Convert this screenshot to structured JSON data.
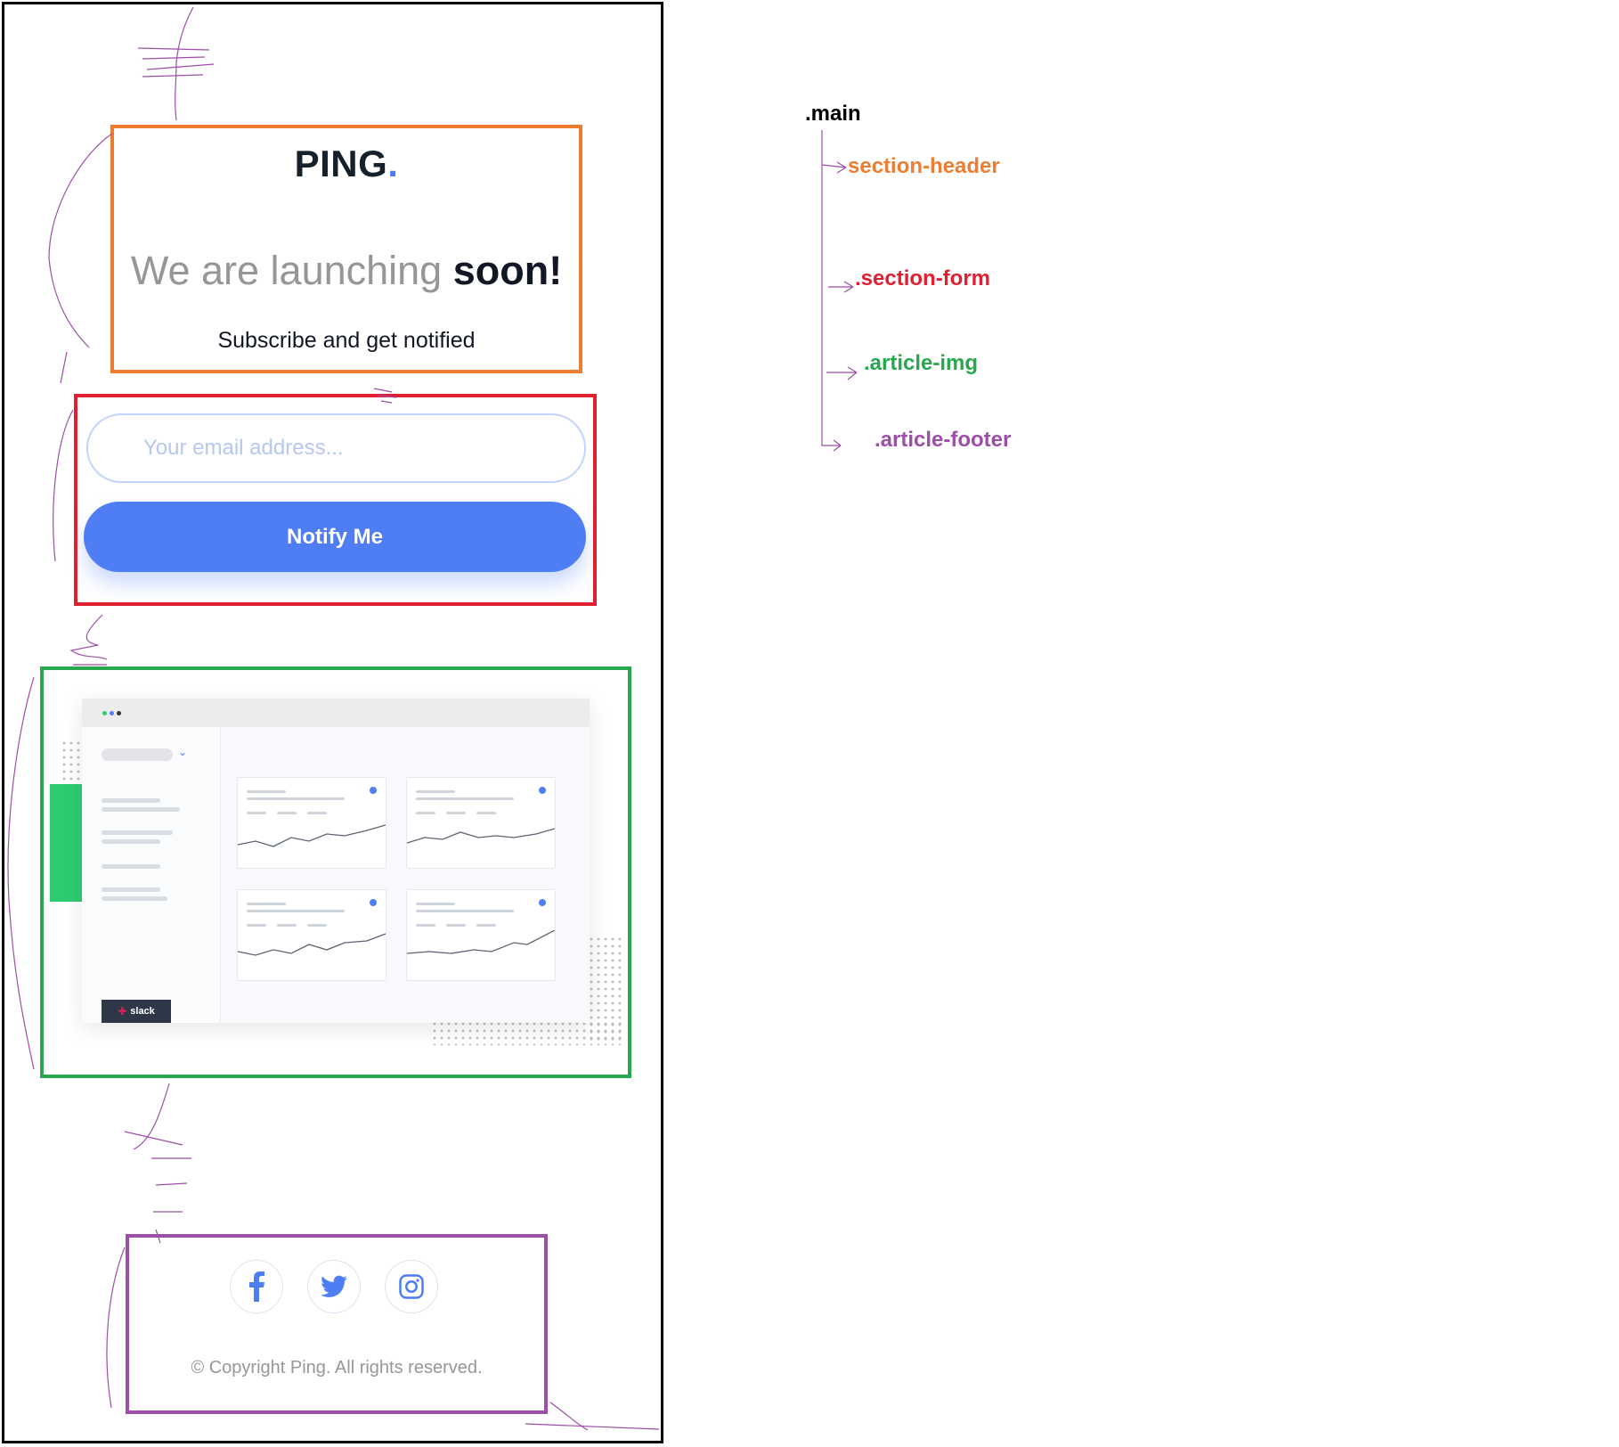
{
  "header": {
    "logo_text": "PING",
    "logo_dot": ".",
    "headline_light": "We are launching ",
    "headline_bold": "soon!",
    "subtitle": "Subscribe and get notified"
  },
  "form": {
    "email_placeholder": "Your email address...",
    "email_value": "",
    "button_label": "Notify Me"
  },
  "illustration": {
    "slack_label": "slack"
  },
  "footer": {
    "social_icons": [
      "facebook-icon",
      "twitter-icon",
      "instagram-icon"
    ],
    "copyright": "© Copyright Ping. All rights reserved."
  },
  "annotations": {
    "root": ".main",
    "header": "section-header",
    "form": ".section-form",
    "image": ".article-img",
    "footer": ".article-footer"
  },
  "colors": {
    "accent": "#4f7df3",
    "heading": "#121725",
    "muted": "#969696",
    "header_box": "#ed7d31",
    "form_box": "#e02030",
    "image_box": "#27a84f",
    "footer_box": "#9d4ea8"
  }
}
